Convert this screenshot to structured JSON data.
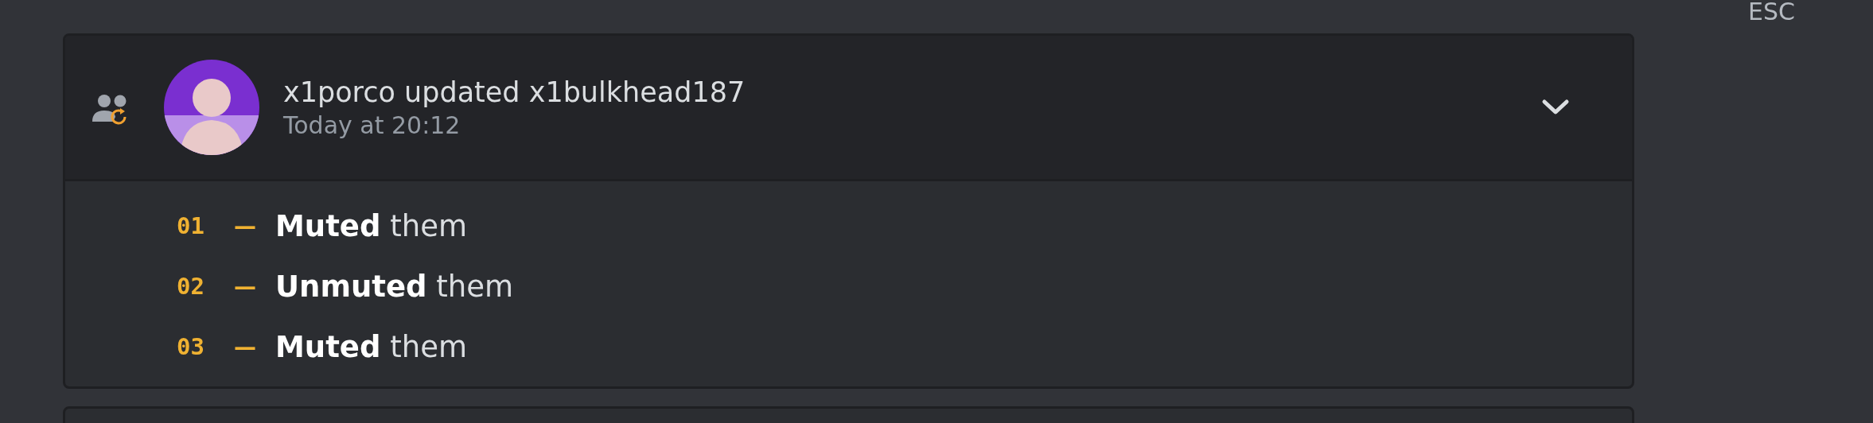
{
  "esc_label": "ESC",
  "entry": {
    "title": "x1porco updated x1bulkhead187",
    "timestamp": "Today at 20:12",
    "expanded": true,
    "changes": [
      {
        "number": "01",
        "dash": "—",
        "text": "**Muted** them"
      },
      {
        "number": "02",
        "dash": "—",
        "text": "**Unmuted** them"
      },
      {
        "number": "03",
        "dash": "—",
        "text": "**Muted** them"
      }
    ]
  }
}
